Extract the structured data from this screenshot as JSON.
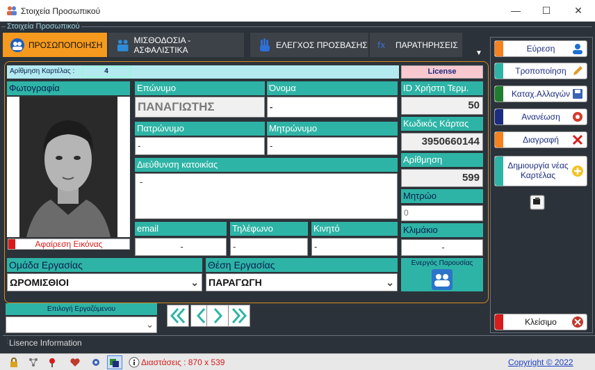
{
  "window": {
    "title": "Στοιχεία Προσωπικού",
    "minimize": "—",
    "maximize": "☐",
    "close": "✕"
  },
  "group": {
    "label": "Στοιχεία Προσωπικού"
  },
  "tabs": [
    {
      "label": "ΠΡΟΣΩΠΟΠΟΙΗΣΗ",
      "icon": "people-icon",
      "active": true
    },
    {
      "label": "ΜΙΣΘΟΔΟΣΙΑ - ΑΣΦΑΛΙΣΤΙΚΑ",
      "icon": "payroll-icon",
      "active": false
    },
    {
      "label": "ΕΛΕΓΧΟΣ ΠΡΟΣΒΑΣΗΣ",
      "icon": "hand-icon",
      "active": false
    },
    {
      "label": "ΠΑΡΑΤΗΡΗΣΕΙΣ",
      "icon": "notes-icon",
      "active": false
    }
  ],
  "card": {
    "label": "Αρίθμηση Καρτέλας :",
    "value": "4",
    "license": "License"
  },
  "photo": {
    "label": "Φωτογραφία",
    "remove_label": "Αφαίρεση Εικόνας"
  },
  "fields": {
    "surname": {
      "label": "Επώνυμο",
      "value": "ΠΑΝΑΓΙΩΤΗΣ"
    },
    "name": {
      "label": "Όνομα",
      "value": "-"
    },
    "father": {
      "label": "Πατρώνυμο",
      "value": "-"
    },
    "mother": {
      "label": "Μητρώνυμο",
      "value": "-"
    },
    "address": {
      "label": "Διεύθυνση κατοικίας",
      "value": "-"
    },
    "email": {
      "label": "email",
      "value": "-"
    },
    "phone": {
      "label": "Τηλέφωνο",
      "value": "-"
    },
    "mobile": {
      "label": "Κινητό",
      "value": "-"
    },
    "user_id": {
      "label": "ID Χρήστη Τερμ.",
      "value": "50"
    },
    "card_code": {
      "label": "Κωδικός Κάρτας",
      "value": "3950660144"
    },
    "numbering": {
      "label": "Αρίθμηση",
      "value": "599"
    },
    "registry": {
      "label": "Μητρώο",
      "value": "0"
    },
    "scale": {
      "label": "Κλιμάκιο",
      "value": "-"
    }
  },
  "work_group": {
    "label": "Ομάδα Εργασίας",
    "value": "ΩΡΟΜΙΣΘΙΟΙ"
  },
  "work_position": {
    "label": "Θέση Εργασίας",
    "value": "ΠΑΡΑΓΩΓΗ"
  },
  "presence": {
    "label": "Ενεργός Παρουσίας"
  },
  "employee_select": {
    "label": "Επιλογή Εργαζόμενου",
    "value": ""
  },
  "actions": [
    {
      "label": "Εύρεση",
      "color": "#f5821f",
      "icon": "search-user-icon"
    },
    {
      "label": "Τροποποίηση",
      "color": "#2eb4a6",
      "icon": "pencil-icon"
    },
    {
      "label": "Καταχ.Αλλαγών",
      "color": "#1e7d2e",
      "icon": "save-icon"
    },
    {
      "label": "Ανανέωση",
      "color": "#1c2c80",
      "icon": "refresh-icon"
    },
    {
      "label": "Διαγραφή",
      "color": "#f5821f",
      "icon": "delete-icon"
    },
    {
      "label": "Δημιουργία νέας Καρτέλας",
      "color": "#2eb4a6",
      "icon": "add-icon"
    }
  ],
  "close_button": {
    "label": "Κλείσιμο",
    "color": "#d81b1b"
  },
  "licence_info": "Lisence Information",
  "status": {
    "dimensions": "Διαστάσεις : 870 x 539",
    "copyright": "Copyright ©  2022"
  }
}
